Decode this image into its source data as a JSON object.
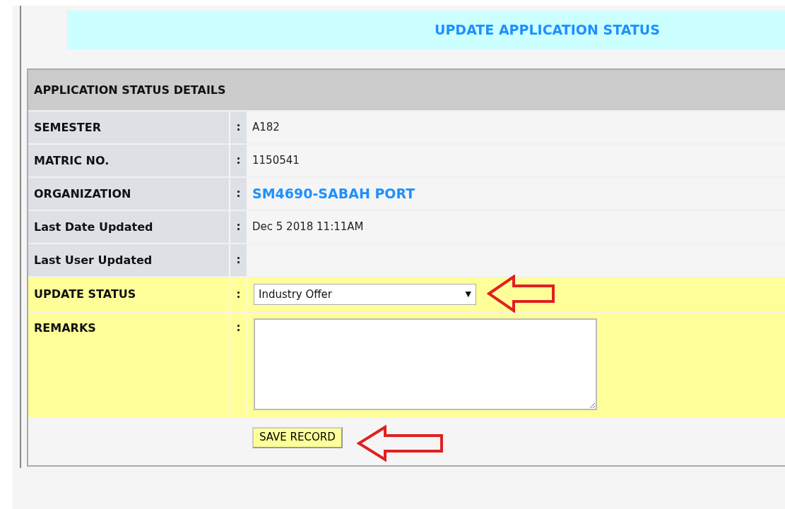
{
  "banner": {
    "title": "UPDATE APPLICATION STATUS"
  },
  "details": {
    "heading": "APPLICATION STATUS DETAILS",
    "rows": [
      {
        "kind": "text",
        "label": "SEMESTER",
        "separator": ":",
        "value": "A182"
      },
      {
        "kind": "text",
        "label": "MATRIC NO.",
        "separator": ":",
        "value": "1150541"
      },
      {
        "kind": "link",
        "label": "ORGANIZATION",
        "separator": ":",
        "value": "SM4690-SABAH PORT"
      },
      {
        "kind": "text",
        "label": "Last Date Updated",
        "separator": ":",
        "value": "Dec 5 2018 11:11AM"
      },
      {
        "kind": "text",
        "label": "Last User Updated",
        "separator": ":"
      },
      {
        "kind": "select",
        "label": "UPDATE STATUS",
        "separator": ":",
        "value": "Industry Offer",
        "caret": "▼"
      },
      {
        "kind": "textarea",
        "label": "REMARKS",
        "separator": ":"
      }
    ],
    "save_button": "SAVE RECORD"
  }
}
